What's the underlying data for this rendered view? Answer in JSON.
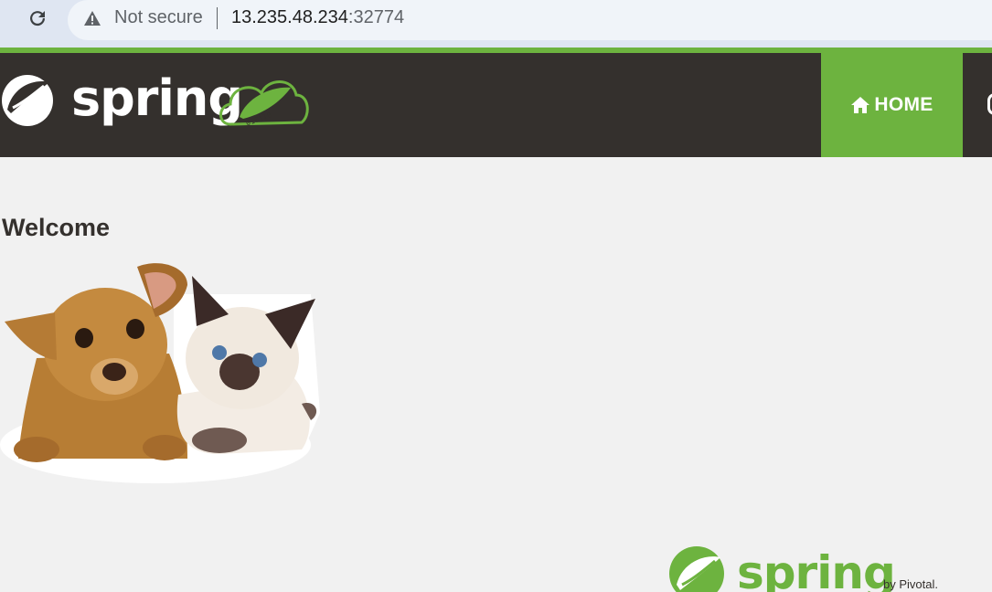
{
  "browser": {
    "security_label": "Not secure",
    "url_host": "13.235.48.234",
    "url_port": ":32774"
  },
  "navbar": {
    "brand": "spring",
    "home_label": "HOME",
    "accent_color": "#6db33f",
    "bg_color": "#34302d"
  },
  "main": {
    "heading": "Welcome",
    "image_icon": "pets-image"
  },
  "footer": {
    "brand": "spring",
    "byline": "by Pivotal."
  }
}
